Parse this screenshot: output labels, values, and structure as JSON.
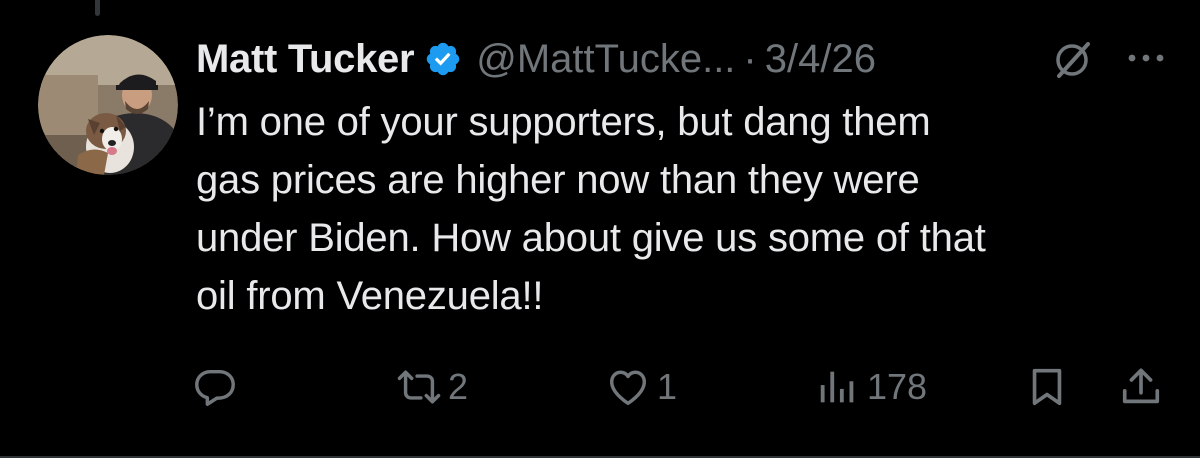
{
  "tweet": {
    "author": {
      "display_name": "Matt Tucker",
      "handle": "@MattTucke...",
      "verified": true,
      "avatar": "avatar-photo"
    },
    "separator": "·",
    "date": "3/4/26",
    "text_lines": [
      "I’m one of your supporters, but dang them",
      "gas prices are higher now than they were",
      "under Biden. How about give us some of that",
      "oil from Venezuela!!"
    ],
    "actions": {
      "reply": {
        "icon": "reply-icon"
      },
      "repost": {
        "icon": "repost-icon",
        "count": "2"
      },
      "like": {
        "icon": "heart-icon",
        "count": "1"
      },
      "views": {
        "icon": "views-icon",
        "count": "178"
      },
      "bookmark": {
        "icon": "bookmark-icon"
      },
      "share": {
        "icon": "share-icon"
      }
    },
    "header_icons": [
      "grok-icon",
      "more-icon"
    ]
  },
  "colors": {
    "background": "#000000",
    "primary_text": "#e7e9ea",
    "secondary_text": "#71767b",
    "verified_blue": "#1d9bf0",
    "divider": "#2f3336"
  }
}
